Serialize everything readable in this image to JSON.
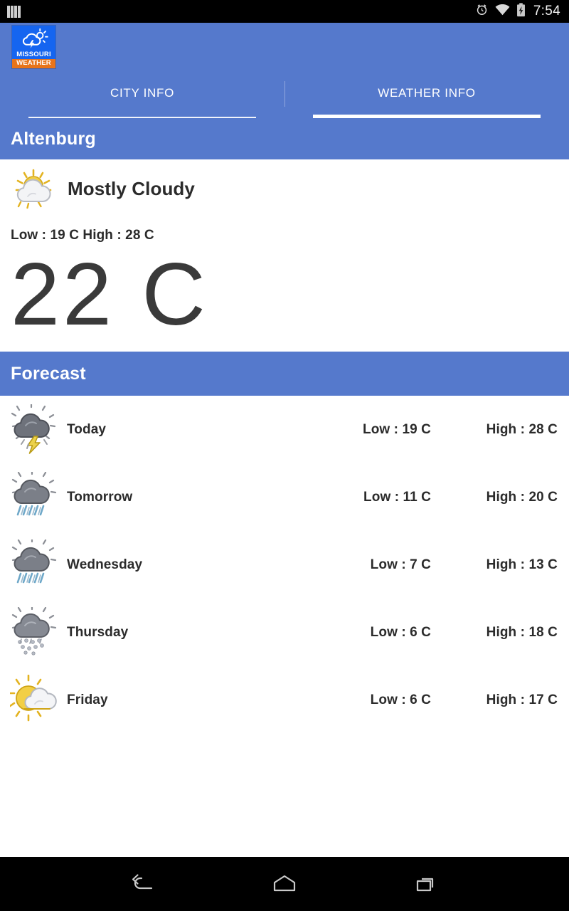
{
  "statusbar": {
    "time": "7:54",
    "icons": [
      "sim-bars-icon",
      "alarm-clock-icon",
      "wifi-icon",
      "battery-charging-icon"
    ]
  },
  "appbar": {
    "logo_line1": "MISSOURI",
    "logo_line2": "WEATHER",
    "logo_icon": "cloud-sun-lightning-icon"
  },
  "tabs": [
    {
      "label": "CITY INFO",
      "active": false
    },
    {
      "label": "WEATHER INFO",
      "active": true
    }
  ],
  "city": {
    "header": "Altenburg"
  },
  "current": {
    "icon": "sun-behind-cloud-icon",
    "condition": "Mostly Cloudy",
    "low_high": "Low : 19 C   High : 28 C",
    "temperature": "22 C"
  },
  "forecast": {
    "header": "Forecast",
    "rows": [
      {
        "day": "Today",
        "icon": "thunderstorm-icon",
        "low": "Low : 19 C",
        "high": "High : 28 C"
      },
      {
        "day": "Tomorrow",
        "icon": "rain-cloud-icon",
        "low": "Low : 11 C",
        "high": "High : 20 C"
      },
      {
        "day": "Wednesday",
        "icon": "rain-cloud-icon",
        "low": "Low : 7 C",
        "high": "High : 13 C"
      },
      {
        "day": "Thursday",
        "icon": "drizzle-cloud-icon",
        "low": "Low : 6 C",
        "high": "High : 18 C"
      },
      {
        "day": "Friday",
        "icon": "sun-behind-cloud-icon",
        "low": "Low : 6 C",
        "high": "High : 17 C"
      }
    ]
  },
  "navbar": {
    "back": "back-icon",
    "home": "home-icon",
    "recents": "recents-icon"
  },
  "colors": {
    "brand_blue": "#5579cc",
    "logo_blue": "#1565f0",
    "logo_orange": "#e8741a",
    "text_dark": "#2b2b2b",
    "bigtemp_gray": "#3a3a3a"
  }
}
